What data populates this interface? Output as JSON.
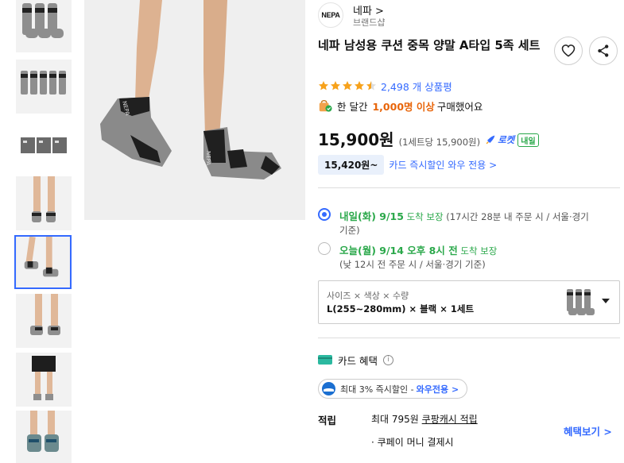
{
  "brand": {
    "logo_text": "NEPA",
    "name": "네파 >",
    "sub": "브랜드샵"
  },
  "product": {
    "title": "네파 남성용 쿠션 중목 양말 A타입 5족 세트",
    "rating": 4.5,
    "review_count": "2,498 개 상품평",
    "buy_prefix": "한 달간",
    "buy_highlight": "1,000명 이상",
    "buy_suffix": "구매했어요"
  },
  "price": {
    "main": "15,900원",
    "unit": "(1세트당 15,900원)",
    "rocket_label": "로켓",
    "rocket_badge": "내일",
    "card_chip": "15,420원~",
    "card_text": "카드 즉시할인 와우 전용 >"
  },
  "shipping": [
    {
      "selected": true,
      "day": "내일(화) 9/15",
      "arrive": "도착 보장",
      "detail": "(17시간 28분 내 주문 시 / 서울·경기",
      "line2": "기준)"
    },
    {
      "selected": false,
      "day": "오늘(월) 9/14 오후 8시 전",
      "arrive": "도착 보장",
      "detail": "",
      "line2": "(낮 12시 전 주문 시 / 서울·경기 기준)"
    }
  ],
  "option": {
    "header": "사이즈 × 색상 × 수량",
    "value": "L(255~280mm) × 블랙 × 1세트"
  },
  "benefits": {
    "header": "카드 혜택",
    "info": "i",
    "pill_prefix": "최대 3% 즉시할인 -",
    "pill_bold": "와우전용 >",
    "accrual_label": "적립",
    "accrual_max": "최대 795원",
    "accrual_link": "쿠팡캐시 적립",
    "accrual_line2": "· 쿠페이 머니 결제시",
    "link": "혜택보기 >"
  },
  "colors": {
    "accent": "#346aff",
    "green": "#2aa84a",
    "orange": "#e8650a",
    "star": "#f7a21b"
  }
}
